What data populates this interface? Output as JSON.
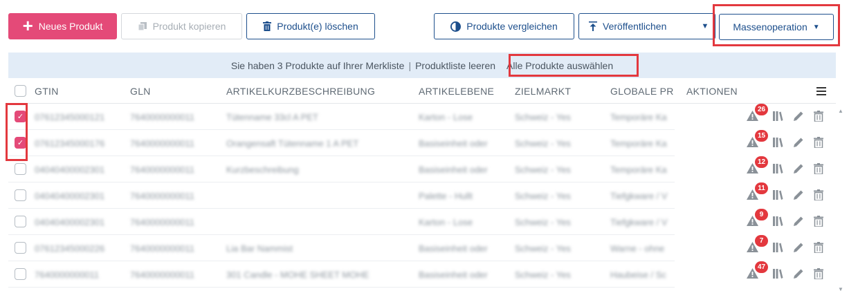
{
  "toolbar": {
    "new_product": "Neues Produkt",
    "copy_product": "Produkt kopieren",
    "delete_products": "Produkt(e) löschen",
    "compare_products": "Produkte vergleichen",
    "publish": "Veröffentlichen",
    "mass_operation": "Massenoperation",
    "caret": "▼"
  },
  "infobar": {
    "watchlist_text": "Sie haben 3 Produkte auf Ihrer Merkliste",
    "separator": "|",
    "clear_list": "Produktliste leeren",
    "select_all": "Alle Produkte auswählen"
  },
  "table": {
    "headers": {
      "gtin": "GTIN",
      "gln": "GLN",
      "description": "ARTIKELKURZBESCHREIBUNG",
      "level": "ARTIKELEBENE",
      "target_market": "ZIELMARKT",
      "global": "GLOBALE PR",
      "actions": "AKTIONEN"
    },
    "rows": [
      {
        "checked": true,
        "badge": "26",
        "gtin": "07612345000121",
        "gln": "7640000000011",
        "desc": "Tütenname 33cl A PET",
        "level": "Karton - Lose",
        "market": "Schweiz - Yes",
        "global": "Temporäre Ka"
      },
      {
        "checked": true,
        "badge": "15",
        "gtin": "07612345000176",
        "gln": "7640000000011",
        "desc": "Orangensaft Tütenname 1 A PET",
        "level": "Basiseinheit oder",
        "market": "Schweiz - Yes",
        "global": "Temporäre Ka"
      },
      {
        "checked": false,
        "badge": "12",
        "gtin": "04040400002301",
        "gln": "7640000000011",
        "desc": "Kurzbeschreibung",
        "level": "Basiseinheit oder",
        "market": "Schweiz - Yes",
        "global": "Temporäre Ka"
      },
      {
        "checked": false,
        "badge": "11",
        "gtin": "04040400002301",
        "gln": "7640000000011",
        "desc": "",
        "level": "Palette - Hullt",
        "market": "Schweiz - Yes",
        "global": "Tiefgkware / V"
      },
      {
        "checked": false,
        "badge": "9",
        "gtin": "04040400002301",
        "gln": "7640000000011",
        "desc": "",
        "level": "Karton - Lose",
        "market": "Schweiz - Yes",
        "global": "Tiefgkware / V"
      },
      {
        "checked": false,
        "badge": "7",
        "gtin": "07612345000226",
        "gln": "7640000000011",
        "desc": "Lia Bar Nammist",
        "level": "Basiseinheit oder",
        "market": "Schweiz - Yes",
        "global": "Warne - ohne"
      },
      {
        "checked": false,
        "badge": "47",
        "gtin": "7640000000011",
        "gln": "7640000000011",
        "desc": "301 Candle - MOHE SHEET MOHE",
        "level": "Basiseinheit oder",
        "market": "Schweiz - Yes",
        "global": "Haubeise / Sc"
      }
    ]
  },
  "colors": {
    "accent_pink": "#e44a78",
    "brand_blue": "#1d4f8c",
    "highlight_red": "#e3383e",
    "info_bg": "#e2ecf7"
  }
}
